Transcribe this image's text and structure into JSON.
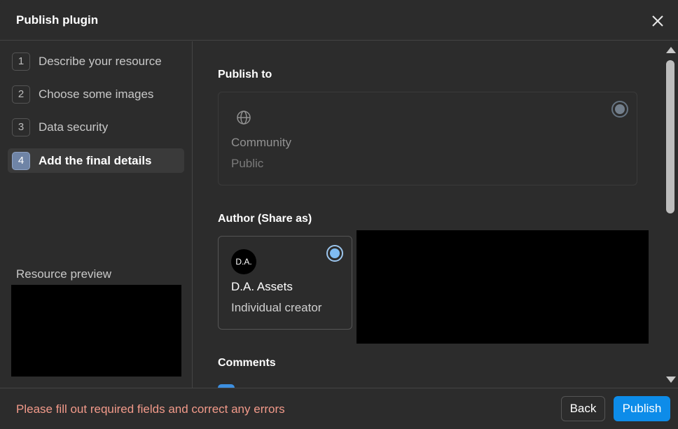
{
  "dialog": {
    "title": "Publish plugin"
  },
  "steps": [
    {
      "num": "1",
      "label": "Describe your resource",
      "active": false
    },
    {
      "num": "2",
      "label": "Choose some images",
      "active": false
    },
    {
      "num": "3",
      "label": "Data security",
      "active": false
    },
    {
      "num": "4",
      "label": "Add the final details",
      "active": true
    }
  ],
  "preview": {
    "label": "Resource preview"
  },
  "publish_to": {
    "title": "Publish to",
    "option": {
      "name": "Community",
      "sub": "Public",
      "icon": "globe-icon",
      "selected": true
    }
  },
  "author": {
    "title": "Author (Share as)",
    "option": {
      "avatar": "D.A.",
      "name": "D.A. Assets",
      "sub": "Individual creator",
      "selected": true
    }
  },
  "comments": {
    "title": "Comments"
  },
  "footer": {
    "error": "Please fill out required fields and correct any errors",
    "back_label": "Back",
    "publish_label": "Publish"
  },
  "colors": {
    "accent": "#0d8ce9",
    "error": "#f29a8a",
    "active_step": "#6f84a6"
  }
}
